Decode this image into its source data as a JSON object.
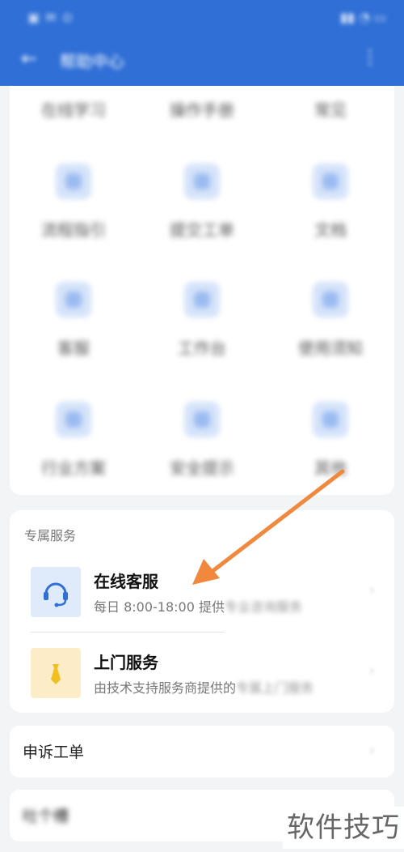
{
  "status_bar": {
    "left": "▣ ✉ ⊙",
    "right": "▮▮ ◔ ▭"
  },
  "header": {
    "title": "帮助中心"
  },
  "grid": {
    "top_row": [
      "在线学习",
      "操作手册",
      "常见"
    ],
    "rows": [
      [
        "流程指引",
        "提交工单",
        "文档"
      ],
      [
        "客服",
        "工作台",
        "使用须知"
      ],
      [
        "行业方案",
        "安全提示",
        "其他"
      ]
    ]
  },
  "services": {
    "header": "专属服务",
    "items": [
      {
        "title": "在线客服",
        "desc_clear": "每日 8:00-18:00 提供",
        "desc_fuzzy": "专业咨询服务",
        "icon": "headset-icon",
        "icon_bg": "#dfeafb"
      },
      {
        "title": "上门服务",
        "desc_clear": "由技术支持服务商提供的",
        "desc_fuzzy": "专属上门服务",
        "icon": "tie-icon",
        "icon_bg": "#fdecc8"
      }
    ]
  },
  "list": {
    "appeal": "申诉工单",
    "feedback": "吐个槽"
  },
  "watermark": "软件技巧",
  "colors": {
    "header": "#2f6fd6",
    "arrow": "#f0883e",
    "headset": "#2f6fd6",
    "tie": "#f0c020"
  }
}
